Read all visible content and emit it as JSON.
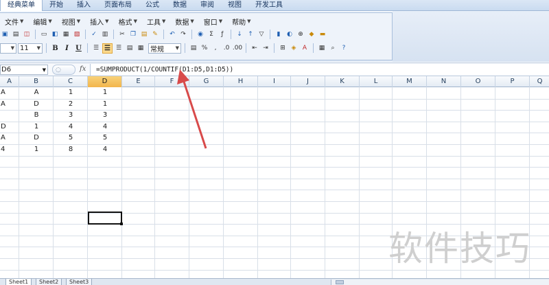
{
  "ribbon": {
    "tabs": [
      "经典菜单",
      "开始",
      "插入",
      "页面布局",
      "公式",
      "数据",
      "审阅",
      "视图",
      "开发工具"
    ]
  },
  "menu": {
    "items": [
      "文件",
      "编辑",
      "视图",
      "插入",
      "格式",
      "工具",
      "数据",
      "窗口",
      "帮助"
    ]
  },
  "toolbar": {
    "font_size": "11",
    "number_format": "常规",
    "percent_label": "%",
    "comma_label": ",",
    "bold_label": "B",
    "italic_label": "I",
    "underline_label": "U"
  },
  "formula_bar": {
    "name_box": "D6",
    "fx_label": "fx",
    "formula": "=SUMPRODUCT(1/COUNTIF(D1:D5,D1:D5))"
  },
  "grid": {
    "columns": [
      "A",
      "B",
      "C",
      "D",
      "E",
      "F",
      "G",
      "H",
      "I",
      "J",
      "K",
      "L",
      "M",
      "N",
      "O",
      "P",
      "Q"
    ],
    "selected_column": "D",
    "rows": [
      [
        "A",
        "A",
        "1",
        "1"
      ],
      [
        "A",
        "D",
        "2",
        "1"
      ],
      [
        "",
        "B",
        "3",
        "3"
      ],
      [
        "D",
        "1",
        "4",
        "4"
      ],
      [
        "A",
        "D",
        "5",
        "5"
      ],
      [
        "4",
        "1",
        "8",
        "4"
      ]
    ],
    "active_cell": "D6"
  },
  "sheets": {
    "tabs": [
      "Sheet1",
      "Sheet2",
      "Sheet3"
    ],
    "active": "Sheet1"
  },
  "annotation": {
    "arrow_color": "#d84a4a"
  },
  "watermark": {
    "text": "软件技巧"
  },
  "colors": {
    "ribbon_bg": "#c9dbf0",
    "selection_header": "#f2b54c",
    "grid_line": "#d8dfe8"
  }
}
